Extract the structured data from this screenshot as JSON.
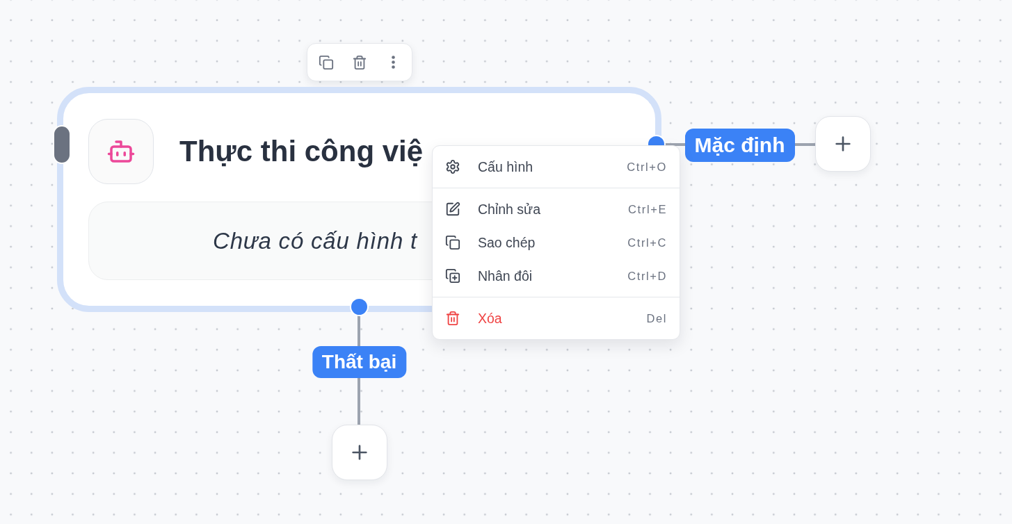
{
  "node": {
    "title": "Thực thi công việ",
    "description": "Chưa có cấu hình t",
    "selected": true
  },
  "branches": [
    {
      "kind": "right",
      "label": "Mặc định"
    },
    {
      "kind": "bottom",
      "label": "Thất bại"
    }
  ],
  "context_menu": {
    "sections": [
      {
        "items": [
          {
            "label": "Cấu hình",
            "shortcut": "Ctrl+O",
            "danger": false
          }
        ]
      },
      {
        "items": [
          {
            "label": "Chỉnh sửa",
            "shortcut": "Ctrl+E",
            "danger": false
          },
          {
            "label": "Sao chép",
            "shortcut": "Ctrl+C",
            "danger": false
          },
          {
            "label": "Nhân đôi",
            "shortcut": "Ctrl+D",
            "danger": false
          }
        ]
      },
      {
        "items": [
          {
            "label": "Xóa",
            "shortcut": "Del",
            "danger": true
          }
        ]
      }
    ]
  }
}
